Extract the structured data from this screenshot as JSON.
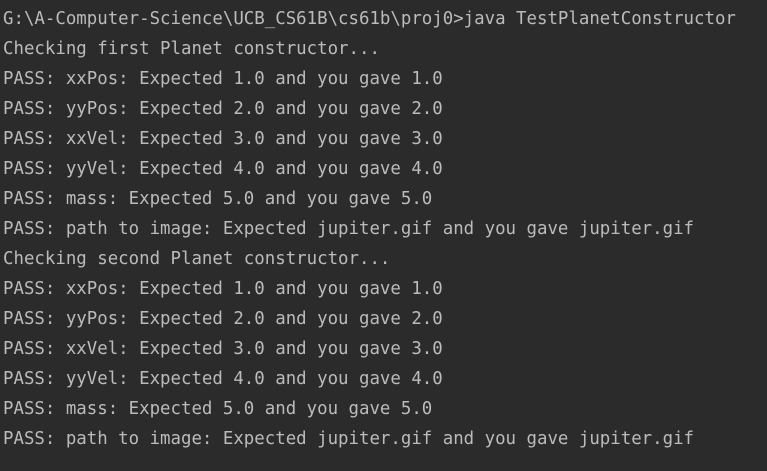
{
  "terminal": {
    "lines": [
      "G:\\A-Computer-Science\\UCB_CS61B\\cs61b\\proj0>java TestPlanetConstructor",
      "Checking first Planet constructor...",
      "PASS: xxPos: Expected 1.0 and you gave 1.0",
      "PASS: yyPos: Expected 2.0 and you gave 2.0",
      "PASS: xxVel: Expected 3.0 and you gave 3.0",
      "PASS: yyVel: Expected 4.0 and you gave 4.0",
      "PASS: mass: Expected 5.0 and you gave 5.0",
      "PASS: path to image: Expected jupiter.gif and you gave jupiter.gif",
      "Checking second Planet constructor...",
      "PASS: xxPos: Expected 1.0 and you gave 1.0",
      "PASS: yyPos: Expected 2.0 and you gave 2.0",
      "PASS: xxVel: Expected 3.0 and you gave 3.0",
      "PASS: yyVel: Expected 4.0 and you gave 4.0",
      "PASS: mass: Expected 5.0 and you gave 5.0",
      "PASS: path to image: Expected jupiter.gif and you gave jupiter.gif"
    ]
  },
  "colors": {
    "background": "#2b2b2b",
    "text": "#bbbbbb"
  }
}
